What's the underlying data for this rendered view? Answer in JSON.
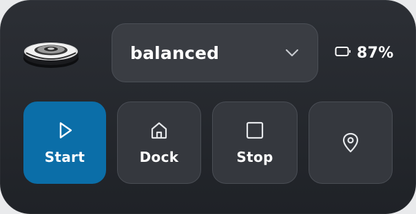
{
  "device": {
    "image_name": "robot-vacuum-image"
  },
  "mode_select": {
    "value": "balanced",
    "icon": "chevron-down-icon"
  },
  "battery": {
    "level_label": "87%",
    "icon": "battery-icon"
  },
  "actions": [
    {
      "label": "Start",
      "icon": "play-icon",
      "active": true
    },
    {
      "label": "Dock",
      "icon": "home-icon",
      "active": false
    },
    {
      "label": "Stop",
      "icon": "stop-icon",
      "active": false
    },
    {
      "label": "",
      "icon": "location-pin-icon",
      "active": false
    }
  ],
  "colors": {
    "card_bg": "#26292e",
    "button_bg": "#35383e",
    "accent": "#0b6ea8",
    "text": "#ffffff",
    "icon": "#e6e8eb"
  }
}
